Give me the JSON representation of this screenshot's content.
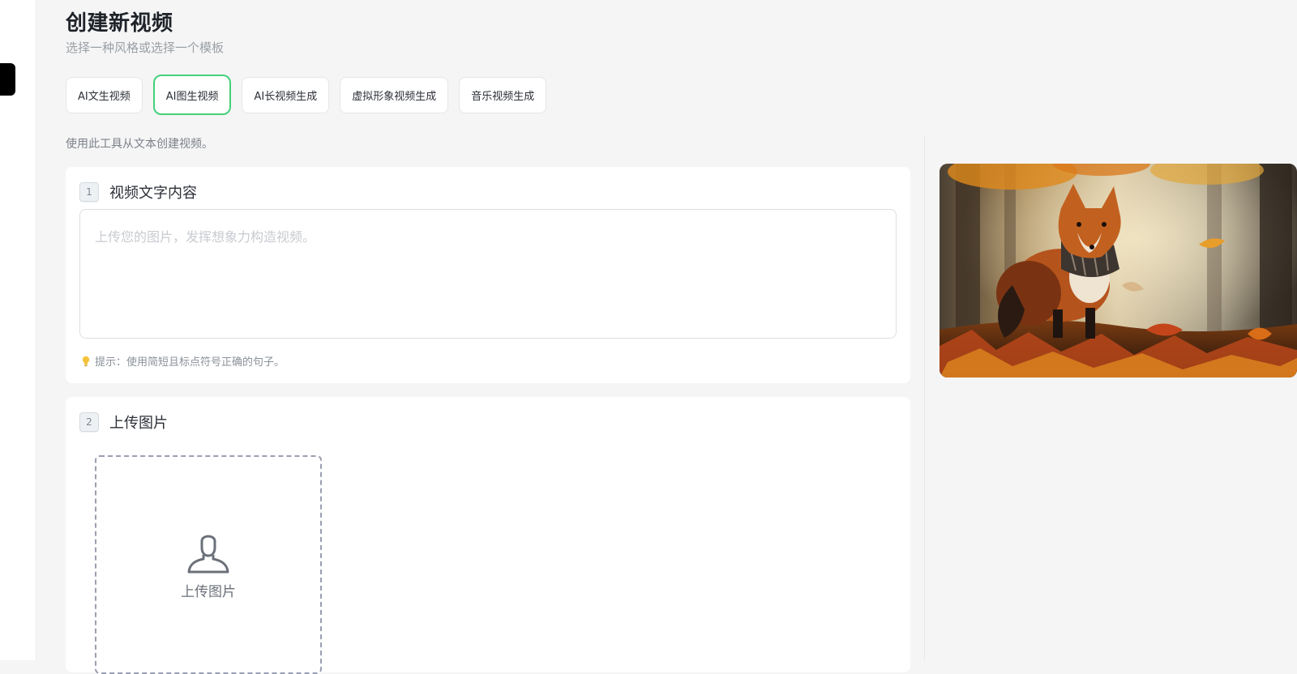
{
  "header": {
    "title": "创建新视频",
    "subtitle": "选择一种风格或选择一个模板"
  },
  "tabs": [
    {
      "label": "AI文生视频",
      "active": false
    },
    {
      "label": "AI图生视频",
      "active": true
    },
    {
      "label": "AI长视频生成",
      "active": false
    },
    {
      "label": "虚拟形象视频生成",
      "active": false
    },
    {
      "label": "音乐视频生成",
      "active": false
    }
  ],
  "description": "使用此工具从文本创建视频。",
  "step1": {
    "number": "1",
    "title": "视频文字内容",
    "placeholder": "上传您的图片，发挥想象力构造视频。",
    "value": "",
    "hint": "提示：使用简短且标点符号正确的句子。",
    "hint_icon": "lightbulb-icon"
  },
  "step2": {
    "number": "2",
    "title": "上传图片",
    "upload_label": "上传图片",
    "upload_icon": "user-upload-icon"
  },
  "preview": {
    "subject": "fox-in-autumn-forest-image"
  },
  "colors": {
    "accent": "#44d07a",
    "background": "#f5f5f5",
    "card": "#ffffff"
  }
}
